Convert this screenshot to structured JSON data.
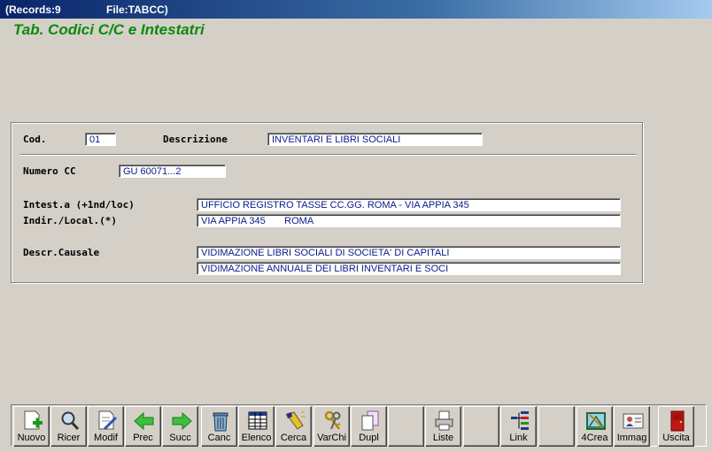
{
  "window": {
    "records": "(Records:9",
    "file": "File:TABCC)"
  },
  "form_title": "Tab. Codici C/C e Intestatri",
  "fields": {
    "cod_label": "Cod.",
    "cod_value": "01",
    "descrizione_label": "Descrizione",
    "descrizione_value": "INVENTARI E LIBRI SOCIALI",
    "numero_cc_label": "Numero CC",
    "numero_cc_value": "GU 60071...2",
    "intest_label": "Intest.a (+1nd/loc)",
    "intest_value": "UFFICIO REGISTRO TASSE CC.GG. ROMA - VIA APPIA 345",
    "indir_label": "Indir./Local.(*)",
    "indir_value": "VIA APPIA 345       ROMA",
    "causale_label": "Descr.Causale",
    "causale_value_1": "VIDIMAZIONE LIBRI SOCIALI DI SOCIETA' DI CAPITALI",
    "causale_value_2": "VIDIMAZIONE ANNUALE DEI LIBRI INVENTARI E SOCI"
  },
  "toolbar": {
    "nuovo": "Nuovo",
    "ricer": "Ricer",
    "modif": "Modif",
    "prec": "Prec",
    "succ": "Succ",
    "canc": "Canc",
    "elenco": "Elenco",
    "cerca": "Cerca",
    "varchi": "VarChi",
    "dupl": "Dupl",
    "liste": "Liste",
    "link": "Link",
    "crea4": "4Crea",
    "immag": "Immag",
    "uscita": "Uscita"
  },
  "colors": {
    "title_green": "#0a8a0a",
    "field_text": "#0a1a8a",
    "background": "#d4d0c8",
    "titlebar": "#0a246a"
  }
}
